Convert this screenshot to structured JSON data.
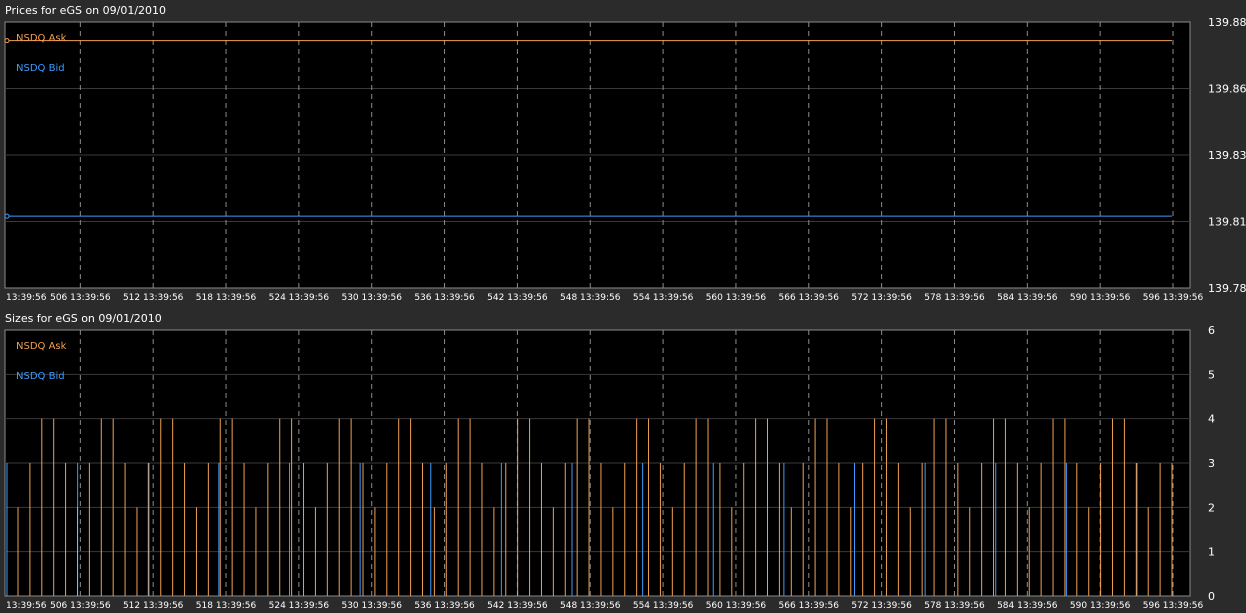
{
  "chart_data": [
    {
      "type": "line",
      "title": "Prices for  eGS  on  09/01/2010",
      "ylim": [
        139.78,
        139.88
      ],
      "y_ticks": [
        "139.88",
        "139.86",
        "139.83",
        "139.81",
        "139.78"
      ],
      "x_tick_labels": [
        "13:39:56",
        "506 13:39:56",
        "512 13:39:56",
        "518 13:39:56",
        "524 13:39:56",
        "530 13:39:56",
        "536 13:39:56",
        "542 13:39:56",
        "548 13:39:56",
        "554 13:39:56",
        "560 13:39:56",
        "566 13:39:56",
        "572 13:39:56",
        "578 13:39:56",
        "584 13:39:56",
        "590 13:39:56",
        "596 13:39:56"
      ],
      "grid": true,
      "legend": "top-left",
      "series": [
        {
          "name": "NSDQ Ask",
          "color": "#f0a050",
          "values": [
            139.873,
            139.873
          ]
        },
        {
          "name": "NSDQ Bid",
          "color": "#3d9bff",
          "values": [
            139.807,
            139.807
          ]
        }
      ]
    },
    {
      "type": "bar",
      "title": "Sizes for  eGS  on  09/01/2010",
      "ylim": [
        0,
        6
      ],
      "y_ticks": [
        "6",
        "5",
        "4",
        "3",
        "2",
        "1",
        "0"
      ],
      "x_tick_labels": [
        "13:39:56",
        "506 13:39:56",
        "512 13:39:56",
        "518 13:39:56",
        "524 13:39:56",
        "530 13:39:56",
        "536 13:39:56",
        "542 13:39:56",
        "548 13:39:56",
        "554 13:39:56",
        "560 13:39:56",
        "566 13:39:56",
        "572 13:39:56",
        "578 13:39:56",
        "584 13:39:56",
        "590 13:39:56",
        "596 13:39:56"
      ],
      "grid": true,
      "legend": "top-left",
      "series": [
        {
          "name": "NSDQ Ask",
          "color": "#f0a050",
          "values": [
            2,
            3,
            4,
            4,
            3,
            2,
            3,
            4,
            4,
            3,
            2,
            3,
            4,
            4,
            3,
            2,
            3,
            4,
            4,
            3,
            2,
            3,
            4,
            4,
            3,
            2,
            3,
            4,
            4,
            3,
            2,
            3,
            4,
            4,
            3,
            2,
            3,
            4,
            4,
            3,
            2,
            3,
            4,
            4,
            3,
            2,
            3,
            4,
            4,
            3,
            2,
            3,
            4,
            4,
            3,
            2,
            3,
            4,
            4,
            3,
            2,
            3,
            4,
            4,
            3,
            2,
            3,
            4,
            4,
            3,
            2,
            3,
            4,
            4,
            3,
            2,
            3,
            4,
            4,
            3,
            2,
            3,
            4,
            4,
            3,
            2,
            3,
            4,
            4,
            3,
            2,
            3,
            4,
            4,
            3,
            2,
            3,
            3
          ]
        },
        {
          "name": "NSDQ Bid",
          "color": "#3d9bff",
          "values": [
            3,
            3,
            3,
            3,
            3,
            3,
            3,
            3,
            3,
            3,
            3,
            3,
            3,
            3,
            3,
            3,
            3
          ]
        }
      ]
    }
  ]
}
